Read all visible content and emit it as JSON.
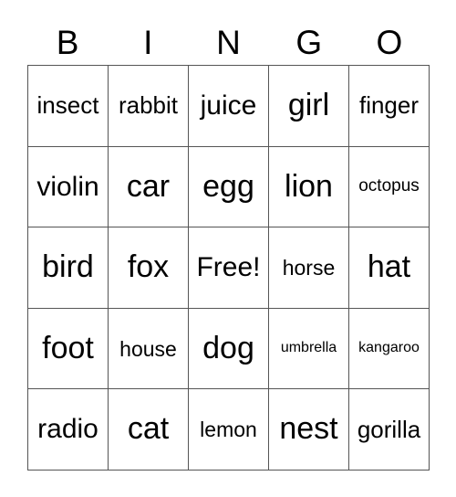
{
  "card": {
    "title": "BINGO",
    "header_letters": [
      "B",
      "I",
      "N",
      "G",
      "O"
    ],
    "columns": 5,
    "rows": 5,
    "free_space_label": "Free!",
    "free_space_position": {
      "row": 3,
      "column": 3
    },
    "border_color": "#555555",
    "background_color": "#ffffff",
    "text_color": "#000000",
    "cells": [
      [
        {
          "text": "insect",
          "size": "md"
        },
        {
          "text": "rabbit",
          "size": "md"
        },
        {
          "text": "juice",
          "size": "lg"
        },
        {
          "text": "girl",
          "size": "xl"
        },
        {
          "text": "finger",
          "size": "md"
        }
      ],
      [
        {
          "text": "violin",
          "size": "lg"
        },
        {
          "text": "car",
          "size": "xl"
        },
        {
          "text": "egg",
          "size": "xl"
        },
        {
          "text": "lion",
          "size": "xl"
        },
        {
          "text": "octopus",
          "size": "xs"
        }
      ],
      [
        {
          "text": "bird",
          "size": "xl"
        },
        {
          "text": "fox",
          "size": "xl"
        },
        {
          "text": "Free!",
          "size": "lg"
        },
        {
          "text": "horse",
          "size": "sm"
        },
        {
          "text": "hat",
          "size": "xl"
        }
      ],
      [
        {
          "text": "foot",
          "size": "xl"
        },
        {
          "text": "house",
          "size": "sm"
        },
        {
          "text": "dog",
          "size": "xl"
        },
        {
          "text": "umbrella",
          "size": "xxs"
        },
        {
          "text": "kangaroo",
          "size": "xxs"
        }
      ],
      [
        {
          "text": "radio",
          "size": "lg"
        },
        {
          "text": "cat",
          "size": "xl"
        },
        {
          "text": "lemon",
          "size": "sm"
        },
        {
          "text": "nest",
          "size": "xl"
        },
        {
          "text": "gorilla",
          "size": "md"
        }
      ]
    ]
  }
}
